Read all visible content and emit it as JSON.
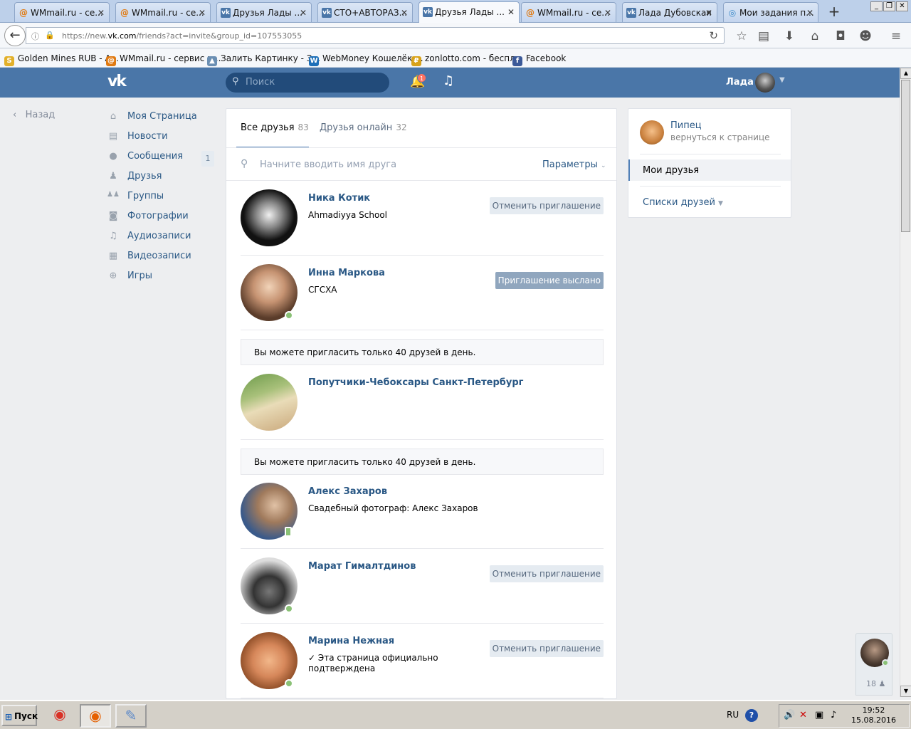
{
  "browser": {
    "tabs": [
      {
        "title": "WMmail.ru - се...",
        "icon": "at-icon"
      },
      {
        "title": "WMmail.ru - се...",
        "icon": "at-icon"
      },
      {
        "title": "Друзья Лады ...",
        "icon": "vk-icon"
      },
      {
        "title": "СТО+АВТОРАЗ...",
        "icon": "vk-icon"
      },
      {
        "title": "Друзья Лады ...",
        "icon": "vk-icon",
        "active": true
      },
      {
        "title": "WMmail.ru - се...",
        "icon": "at-icon"
      },
      {
        "title": "Лада Дубовская",
        "icon": "vk-icon"
      },
      {
        "title": "Мои задания п...",
        "icon": "circle-icon"
      }
    ],
    "url_prefix": "https://new.",
    "url_host": "vk.com",
    "url_rest": "/friends?act=invite&group_id=107553055",
    "bookmarks": [
      {
        "label": "Golden Mines RUB - A...",
        "color": "#e2b02a",
        "glyph": "S"
      },
      {
        "label": "WMmail.ru - сервис п...",
        "color": "#e07a12",
        "glyph": "@"
      },
      {
        "label": "Залить Картинку - З...",
        "color": "#6b8fb3",
        "glyph": "▲"
      },
      {
        "label": "WebMoney Кошелёк ...",
        "color": "#1d6fb8",
        "glyph": "W"
      },
      {
        "label": "zonlotto.com - беспл...",
        "color": "#d8a21a",
        "glyph": "₽"
      },
      {
        "label": "Facebook",
        "color": "#3b5998",
        "glyph": "f"
      }
    ]
  },
  "vk": {
    "search_placeholder": "Поиск",
    "notif_count": "1",
    "user_name": "Лада",
    "back_label": "Назад",
    "nav": [
      {
        "label": "Моя Страница",
        "icon": "home-icon",
        "glyph": "⌂"
      },
      {
        "label": "Новости",
        "icon": "news-icon",
        "glyph": "▤"
      },
      {
        "label": "Сообщения",
        "icon": "messages-icon",
        "glyph": "●"
      },
      {
        "label": "Друзья",
        "icon": "friends-icon",
        "glyph": "♟"
      },
      {
        "label": "Группы",
        "icon": "groups-icon",
        "glyph": "♟♟"
      },
      {
        "label": "Фотографии",
        "icon": "camera-icon",
        "glyph": "◙"
      },
      {
        "label": "Аудиозаписи",
        "icon": "music-icon",
        "glyph": "♫"
      },
      {
        "label": "Видеозаписи",
        "icon": "video-icon",
        "glyph": "▦"
      },
      {
        "label": "Игры",
        "icon": "games-icon",
        "glyph": "⊕"
      }
    ],
    "messages_count": "1",
    "tabs": {
      "all_label": "Все друзья",
      "all_count": "83",
      "online_label": "Друзья онлайн",
      "online_count": "32"
    },
    "friend_search_placeholder": "Начните вводить имя друга",
    "params_label": "Параметры",
    "notice_text": "Вы можете пригласить только 40 друзей в день.",
    "friends": [
      {
        "name": "Ника Котик",
        "sub": "Ahmadiyya School",
        "button": "Отменить приглашение",
        "online": false
      },
      {
        "name": "Инна Маркова",
        "sub": "СГСХА",
        "button": "Приглашение выслано",
        "online": true
      },
      {
        "name": "Попутчики-Чебоксары Санкт-Петербург",
        "sub": "",
        "button": "",
        "online": false
      },
      {
        "name": "Алекс Захаров",
        "sub": "Свадебный фотограф: Алекс Захаров",
        "button": "",
        "online": "mobile"
      },
      {
        "name": "Марат Гималтдинов",
        "sub": "",
        "button": "Отменить приглашение",
        "online": true
      },
      {
        "name": "Марина Нежная",
        "sub": "✓ Эта страница официально подтверждена",
        "button": "Отменить приглашение",
        "online": true
      }
    ],
    "right": {
      "group_name": "Пипец",
      "group_back": "вернуться к странице",
      "my_friends": "Мои друзья",
      "friend_lists": "Списки друзей"
    },
    "chat_count": "18"
  },
  "taskbar": {
    "start_label": "Пуск",
    "lang": "RU",
    "time": "19:52",
    "date": "15.08.2016"
  }
}
